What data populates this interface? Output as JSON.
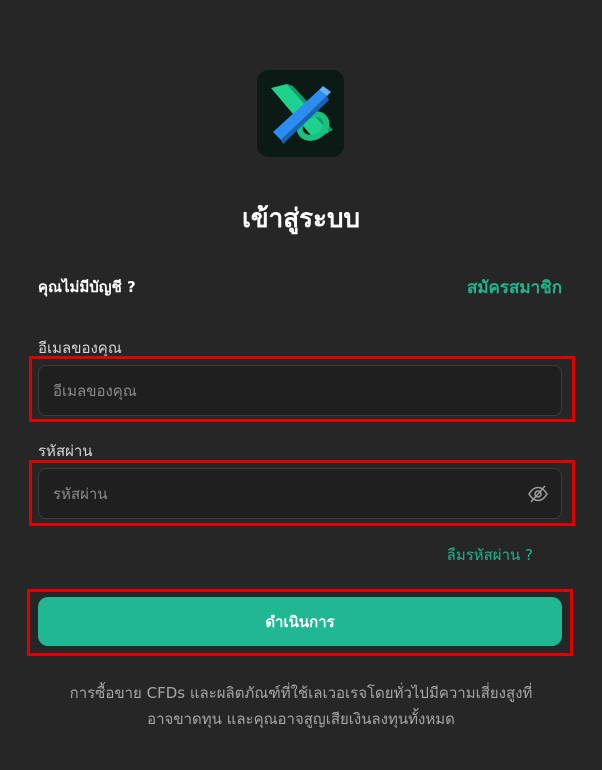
{
  "header": {
    "title": "เข้าสู่ระบบ"
  },
  "signup": {
    "prompt": "คุณไม่มีบัญชี ?",
    "link_label": "สมัครสมาชิก"
  },
  "form": {
    "email_label": "อีเมลของคุณ",
    "email_placeholder": "อีเมลของคุณ",
    "email_value": "",
    "password_label": "รหัสผ่าน",
    "password_placeholder": "รหัสผ่าน",
    "password_value": "",
    "password_toggle_icon": "eye-off-icon",
    "forgot_label": "ลืมรหัสผ่าน ?",
    "submit_label": "ดำเนินการ"
  },
  "disclaimer": {
    "line1": "การซื้อขาย CFDs และผลิตภัณฑ์ที่ใช้เลเวอเรจโดยทั่วไปมีความเสี่ยงสูงที่",
    "line2": "อาจขาดทุน และคุณอาจสูญเสียเงินลงทุนทั้งหมด"
  },
  "colors": {
    "background": "#262626",
    "accent": "#1fb893",
    "highlight": "#e00000"
  }
}
